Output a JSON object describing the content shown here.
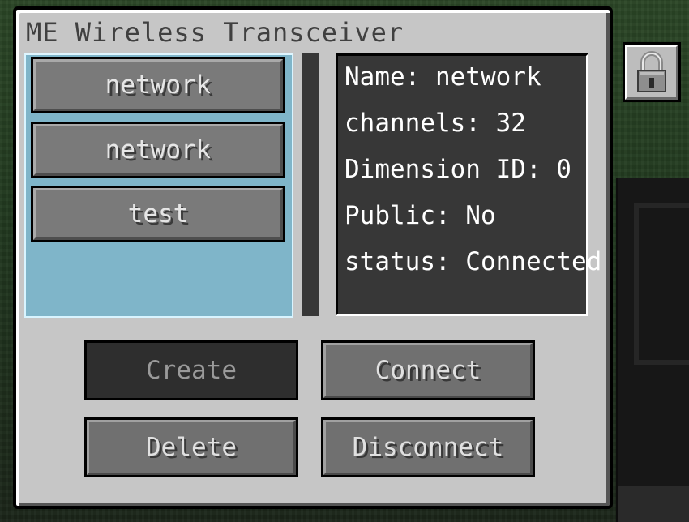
{
  "window": {
    "title": "ME Wireless Transceiver"
  },
  "networks": [
    {
      "label": "network"
    },
    {
      "label": "network"
    },
    {
      "label": "test"
    }
  ],
  "info": {
    "name": "Name: network",
    "channels": "channels: 32",
    "dimension": "Dimension ID: 0",
    "public": "Public: No",
    "status": "status: Connected"
  },
  "buttons": {
    "create": "Create",
    "connect": "Connect",
    "delete": "Delete",
    "disconnect": "Disconnect"
  },
  "icons": {
    "lock": "padlock-icon"
  },
  "colors": {
    "panel": "#c6c6c6",
    "list_background": "#7fb5c9",
    "info_background": "#373737",
    "button": "#707070",
    "button_disabled": "#2e2e2e"
  }
}
